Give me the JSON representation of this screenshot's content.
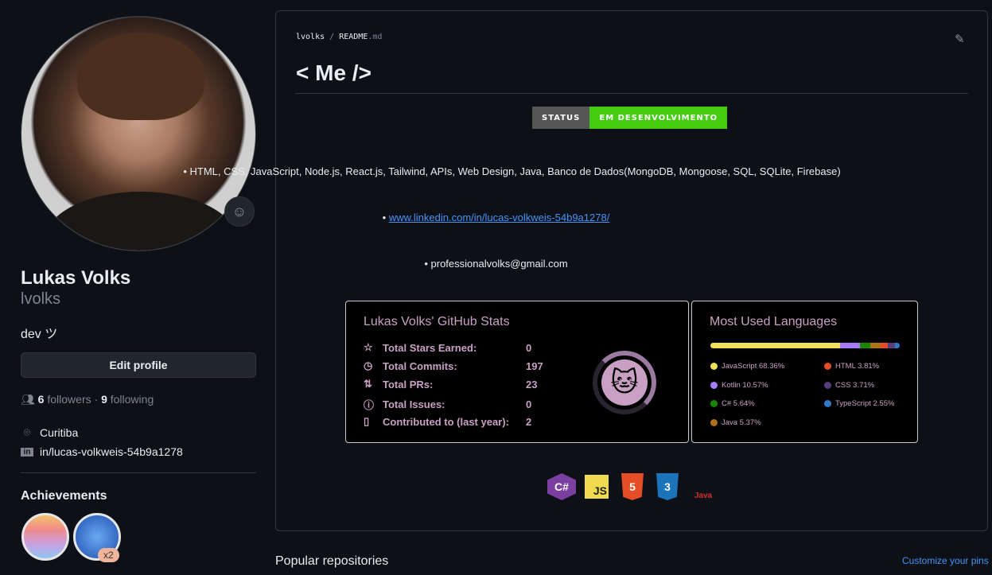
{
  "profile": {
    "name": "Lukas Volks",
    "login": "lvolks",
    "bio": "dev ツ",
    "edit_label": "Edit profile",
    "followers": "6",
    "followers_label": "followers",
    "following": "9",
    "following_label": "following",
    "location": "Curitiba",
    "linkedin": "in/lucas-volkweis-54b9a1278",
    "achievements_title": "Achievements",
    "achievement_count": "x2"
  },
  "readme": {
    "owner": "lvolks",
    "file": "README",
    "ext": ".md",
    "title": "< Me />",
    "status_label": "STATUS",
    "status_value": "EM DESENVOLVIMENTO",
    "status_colors": {
      "label": "#555555",
      "value": "#44cc11"
    },
    "skills": "• HTML, CSS, JavaScript, Node.js, React.js, Tailwind, APIs, Web Design, Java, Banco de Dados(MongoDB, Mongoose, SQL, SQLite, Firebase)",
    "linkedin_bullet": "• ",
    "linkedin_url": "www.linkedin.com/in/lucas-volkweis-54b9a1278/",
    "email": "• professionalvolks@gmail.com"
  },
  "stats": {
    "title": "Lukas Volks' GitHub Stats",
    "rows": [
      {
        "icon": "star-icon",
        "label": "Total Stars Earned:",
        "value": "0"
      },
      {
        "icon": "history-icon",
        "label": "Total Commits:",
        "value": "197"
      },
      {
        "icon": "pull-request-icon",
        "label": "Total PRs:",
        "value": "23"
      },
      {
        "icon": "issue-icon",
        "label": "Total Issues:",
        "value": "0"
      },
      {
        "icon": "repo-icon",
        "label": "Contributed to (last year):",
        "value": "2"
      }
    ]
  },
  "languages": {
    "title": "Most Used Languages",
    "items": [
      {
        "name": "JavaScript 68.36%",
        "pct": 68.36,
        "color": "#f1e05a"
      },
      {
        "name": "Kotlin 10.57%",
        "pct": 10.57,
        "color": "#A97BFF"
      },
      {
        "name": "C# 5.64%",
        "pct": 5.64,
        "color": "#178600"
      },
      {
        "name": "Java 5.37%",
        "pct": 5.37,
        "color": "#b07219"
      },
      {
        "name": "HTML 3.81%",
        "pct": 3.81,
        "color": "#e34c26"
      },
      {
        "name": "CSS 3.71%",
        "pct": 3.71,
        "color": "#563d7c"
      },
      {
        "name": "TypeScript 2.55%",
        "pct": 2.55,
        "color": "#3178c6"
      }
    ]
  },
  "tech": {
    "csharp": "C#",
    "js": "JS",
    "html": "5",
    "css": "3",
    "java": "Java"
  },
  "popular": {
    "title": "Popular repositories",
    "customize": "Customize your pins"
  }
}
